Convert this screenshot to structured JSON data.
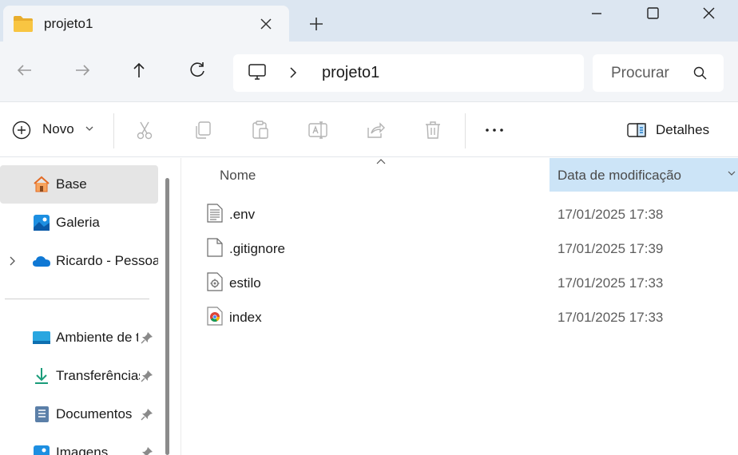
{
  "window": {
    "tab_title": "projeto1"
  },
  "address": {
    "path": "projeto1",
    "search_placeholder": "Procurar"
  },
  "commands": {
    "new_label": "Novo",
    "details_label": "Detalhes"
  },
  "sidebar": {
    "items": [
      {
        "label": "Base",
        "icon": "home-icon",
        "selected": true
      },
      {
        "label": "Galeria",
        "icon": "gallery-icon"
      },
      {
        "label": "Ricardo - Pessoal",
        "icon": "onedrive-icon",
        "expandable": true
      },
      {
        "label": "Ambiente de trabalho",
        "icon": "desktop-icon",
        "pinned": true
      },
      {
        "label": "Transferências",
        "icon": "downloads-icon",
        "pinned": true
      },
      {
        "label": "Documentos",
        "icon": "documents-icon",
        "pinned": true
      },
      {
        "label": "Imagens",
        "icon": "pictures-icon",
        "pinned": true
      }
    ]
  },
  "file_list": {
    "columns": [
      "Nome",
      "Data de modificação"
    ],
    "rows": [
      {
        "name": ".env",
        "modified": "17/01/2025 17:38",
        "icon": "text-file-icon"
      },
      {
        "name": ".gitignore",
        "modified": "17/01/2025 17:39",
        "icon": "blank-file-icon"
      },
      {
        "name": "estilo",
        "modified": "17/01/2025 17:33",
        "icon": "css-file-icon"
      },
      {
        "name": "index",
        "modified": "17/01/2025 17:33",
        "icon": "chrome-html-icon"
      }
    ]
  },
  "colors": {
    "titlebar": "#dce6f1",
    "toolbar": "#f3f5f8",
    "selected_column": "#cce4f7",
    "folder": "#f8c542"
  }
}
